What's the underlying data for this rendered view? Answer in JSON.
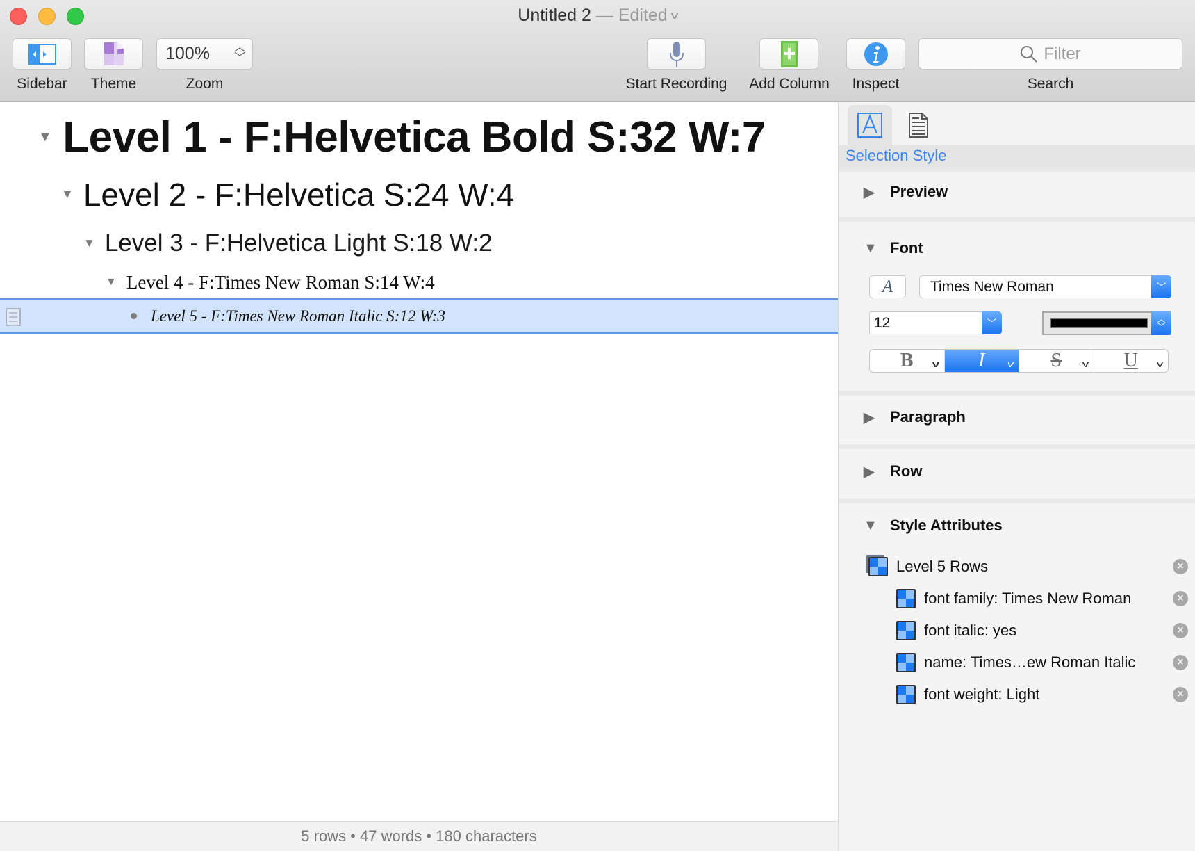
{
  "window": {
    "title": "Untitled 2",
    "title_separator": "—",
    "edited_label": "Edited",
    "title_menu_icon": "chevron-down-icon"
  },
  "toolbar": {
    "sidebar": {
      "label": "Sidebar",
      "icon": "sidebar-toggle-icon"
    },
    "theme": {
      "label": "Theme",
      "icon": "theme-document-icon"
    },
    "zoom": {
      "label": "Zoom",
      "value": "100%"
    },
    "start_recording": {
      "label": "Start Recording",
      "icon": "microphone-icon"
    },
    "add_column": {
      "label": "Add Column",
      "icon": "add-column-icon"
    },
    "inspect": {
      "label": "Inspect",
      "icon": "info-icon"
    },
    "search": {
      "label": "Search",
      "placeholder": "Filter",
      "icon": "magnifier-icon"
    }
  },
  "outline": {
    "rows": [
      {
        "level": 1,
        "text": "Level 1 - F:Helvetica Bold S:32 W:7",
        "expanded": true
      },
      {
        "level": 2,
        "text": "Level 2 - F:Helvetica S:24 W:4",
        "expanded": true
      },
      {
        "level": 3,
        "text": "Level 3 - F:Helvetica Light S:18 W:2",
        "expanded": true
      },
      {
        "level": 4,
        "text": "Level 4 - F:Times New Roman S:14 W:4",
        "expanded": true
      },
      {
        "level": 5,
        "text": "Level 5 - F:Times New Roman Italic S:12 W:3",
        "selected": true,
        "has_note_icon": true
      }
    ],
    "status": "5 rows • 47 words • 180 characters"
  },
  "inspector": {
    "tabs": [
      {
        "name": "selection-style",
        "icon": "text-style-icon",
        "active": true
      },
      {
        "name": "document",
        "icon": "document-icon",
        "active": false
      }
    ],
    "active_tab_label": "Selection Style",
    "sections": {
      "preview": {
        "label": "Preview",
        "expanded": false
      },
      "font": {
        "label": "Font",
        "expanded": true,
        "font_panel_glyph": "A",
        "family": "Times New Roman",
        "size": "12",
        "color": "#000000",
        "styles": [
          {
            "name": "bold",
            "glyph": "B",
            "active": false
          },
          {
            "name": "italic",
            "glyph": "I",
            "active": true
          },
          {
            "name": "strikethrough",
            "glyph": "S",
            "active": false
          },
          {
            "name": "underline",
            "glyph": "U",
            "active": false
          }
        ]
      },
      "paragraph": {
        "label": "Paragraph",
        "expanded": false
      },
      "row": {
        "label": "Row",
        "expanded": false
      },
      "style_attributes": {
        "label": "Style Attributes",
        "expanded": true,
        "group": "Level 5 Rows",
        "items": [
          "font family: Times New Roman",
          "font italic: yes",
          "name: Times…ew Roman Italic",
          "font weight: Light"
        ]
      }
    }
  },
  "colors": {
    "accent_blue": "#1a73f0",
    "selection_fill": "#d2e4fb",
    "selection_border": "#5e98e3",
    "selection_style_label": "#3a85e8"
  }
}
